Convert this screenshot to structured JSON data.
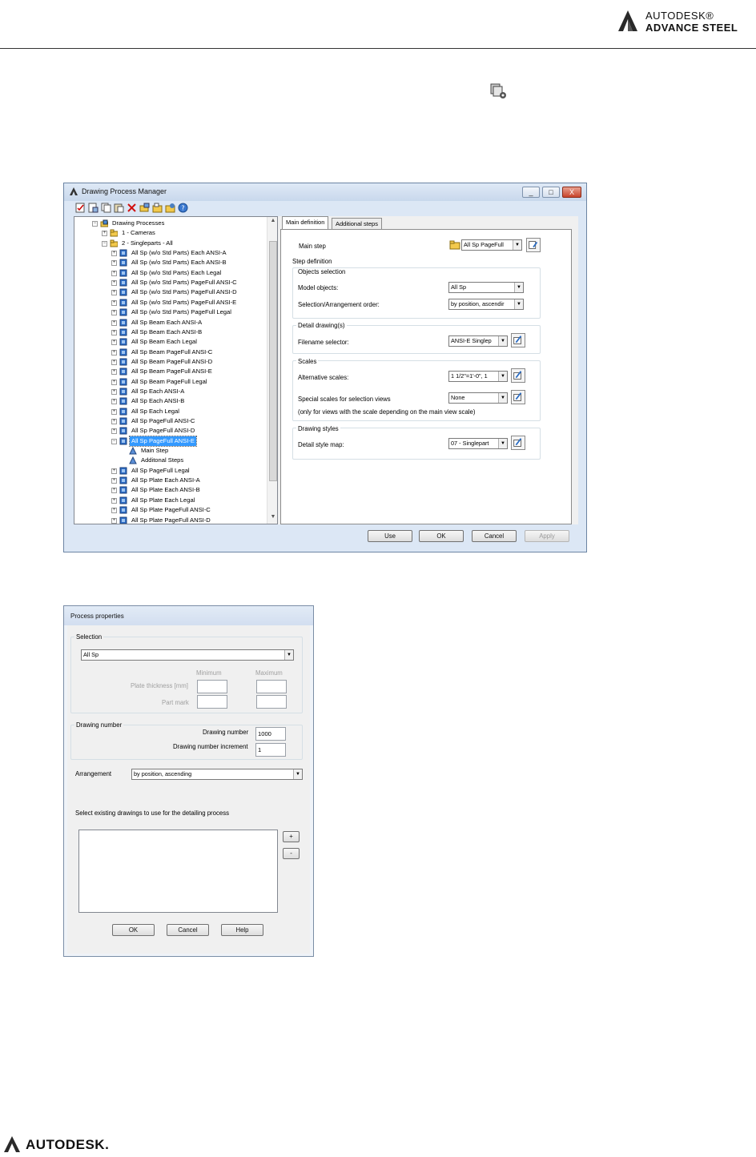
{
  "header": {
    "brand_line1": "AUTODESK®",
    "brand_line2": "ADVANCE STEEL"
  },
  "footer": {
    "brand": "AUTODESK."
  },
  "dpm": {
    "title": "Drawing Process Manager",
    "window_buttons": [
      "_",
      "□",
      "X"
    ],
    "tree": [
      {
        "label": "Drawing Processes",
        "level": 0,
        "icon": "folder-process-icon",
        "exp": "−"
      },
      {
        "label": "1 - Cameras",
        "level": 1,
        "icon": "folder-icon",
        "exp": "+"
      },
      {
        "label": "2 - Singleparts - All",
        "level": 1,
        "icon": "folder-icon",
        "exp": "−"
      },
      {
        "label": "All Sp (w/o Std Parts) Each ANSI-A",
        "level": 2,
        "icon": "process-icon",
        "exp": "+"
      },
      {
        "label": "All Sp (w/o Std Parts) Each ANSI-B",
        "level": 2,
        "icon": "process-icon",
        "exp": "+"
      },
      {
        "label": "All Sp (w/o Std Parts) Each Legal",
        "level": 2,
        "icon": "process-icon",
        "exp": "+"
      },
      {
        "label": "All Sp (w/o Std Parts) PageFull ANSI-C",
        "level": 2,
        "icon": "process-icon",
        "exp": "+"
      },
      {
        "label": "All Sp (w/o Std Parts) PageFull ANSI-D",
        "level": 2,
        "icon": "process-icon",
        "exp": "+"
      },
      {
        "label": "All Sp (w/o Std Parts) PageFull ANSI-E",
        "level": 2,
        "icon": "process-icon",
        "exp": "+"
      },
      {
        "label": "All Sp (w/o Std Parts) PageFull Legal",
        "level": 2,
        "icon": "process-icon",
        "exp": "+"
      },
      {
        "label": "All Sp Beam Each ANSI-A",
        "level": 2,
        "icon": "process-icon",
        "exp": "+"
      },
      {
        "label": "All Sp Beam Each ANSI-B",
        "level": 2,
        "icon": "process-icon",
        "exp": "+"
      },
      {
        "label": "All Sp Beam Each Legal",
        "level": 2,
        "icon": "process-icon",
        "exp": "+"
      },
      {
        "label": "All Sp Beam PageFull ANSI-C",
        "level": 2,
        "icon": "process-icon",
        "exp": "+"
      },
      {
        "label": "All Sp Beam PageFull ANSI-D",
        "level": 2,
        "icon": "process-icon",
        "exp": "+"
      },
      {
        "label": "All Sp Beam PageFull ANSI-E",
        "level": 2,
        "icon": "process-icon",
        "exp": "+"
      },
      {
        "label": "All Sp Beam PageFull Legal",
        "level": 2,
        "icon": "process-icon",
        "exp": "+"
      },
      {
        "label": "All Sp Each ANSI-A",
        "level": 2,
        "icon": "process-icon",
        "exp": "+"
      },
      {
        "label": "All Sp Each ANSI-B",
        "level": 2,
        "icon": "process-icon",
        "exp": "+"
      },
      {
        "label": "All Sp Each Legal",
        "level": 2,
        "icon": "process-icon",
        "exp": "+"
      },
      {
        "label": "All Sp PageFull ANSI-C",
        "level": 2,
        "icon": "process-icon",
        "exp": "+"
      },
      {
        "label": "All Sp PageFull ANSI-D",
        "level": 2,
        "icon": "process-icon",
        "exp": "+"
      },
      {
        "label": "All Sp PageFull ANSI-E",
        "level": 2,
        "icon": "process-icon",
        "exp": "−",
        "selected": true
      },
      {
        "label": "Main Step",
        "level": 3,
        "icon": "step-icon",
        "exp": ""
      },
      {
        "label": "Additonal Steps",
        "level": 3,
        "icon": "step-icon",
        "exp": ""
      },
      {
        "label": "All Sp PageFull Legal",
        "level": 2,
        "icon": "process-icon",
        "exp": "+"
      },
      {
        "label": "All Sp Plate Each ANSI-A",
        "level": 2,
        "icon": "process-icon",
        "exp": "+"
      },
      {
        "label": "All Sp Plate Each ANSI-B",
        "level": 2,
        "icon": "process-icon",
        "exp": "+"
      },
      {
        "label": "All Sp Plate Each Legal",
        "level": 2,
        "icon": "process-icon",
        "exp": "+"
      },
      {
        "label": "All Sp Plate PageFull ANSI-C",
        "level": 2,
        "icon": "process-icon",
        "exp": "+"
      },
      {
        "label": "All Sp Plate PageFull ANSI-D",
        "level": 2,
        "icon": "process-icon",
        "exp": "+"
      }
    ],
    "tabs": [
      "Main definition",
      "Additional steps"
    ],
    "main_step_label": "Main step",
    "main_step_value": "All Sp PageFull",
    "step_definition": "Step definition",
    "objects_selection": "Objects selection",
    "model_objects_label": "Model objects:",
    "model_objects_value": "All Sp",
    "selection_order_label": "Selection/Arrangement order:",
    "selection_order_value": "by position, ascendir",
    "detail_drawings": "Detail drawing(s)",
    "filename_selector_label": "Filename selector:",
    "filename_selector_value": "ANSI-E Singlep",
    "scales": "Scales",
    "alt_scales_label": "Alternative scales:",
    "alt_scales_value": "1 1/2\"=1'-0\", 1",
    "special_scales_label": "Special scales for selection views",
    "special_scales_value": "None",
    "scales_note": "(only for views with the scale depending on the main view scale)",
    "drawing_styles": "Drawing styles",
    "detail_style_label": "Detail style map:",
    "detail_style_value": "07 - Singlepart",
    "buttons": {
      "use": "Use",
      "ok": "OK",
      "cancel": "Cancel",
      "apply": "Apply"
    }
  },
  "pp": {
    "title": "Process properties",
    "selection_group": "Selection",
    "selection_value": "All Sp",
    "minimum": "Minimum",
    "maximum": "Maximum",
    "plate_thickness": "Plate thickness [mm]",
    "part_mark": "Part mark",
    "drawing_number_group": "Drawing number",
    "drawing_number_label": "Drawing number",
    "drawing_number_value": "1000",
    "increment_label": "Drawing number increment",
    "increment_value": "1",
    "arrangement_label": "Arrangement",
    "arrangement_value": "by position, ascending",
    "existing_label": "Select existing drawings to use for the detailing process",
    "plus": "+",
    "minus": "-",
    "buttons": {
      "ok": "OK",
      "cancel": "Cancel",
      "help": "Help"
    }
  }
}
